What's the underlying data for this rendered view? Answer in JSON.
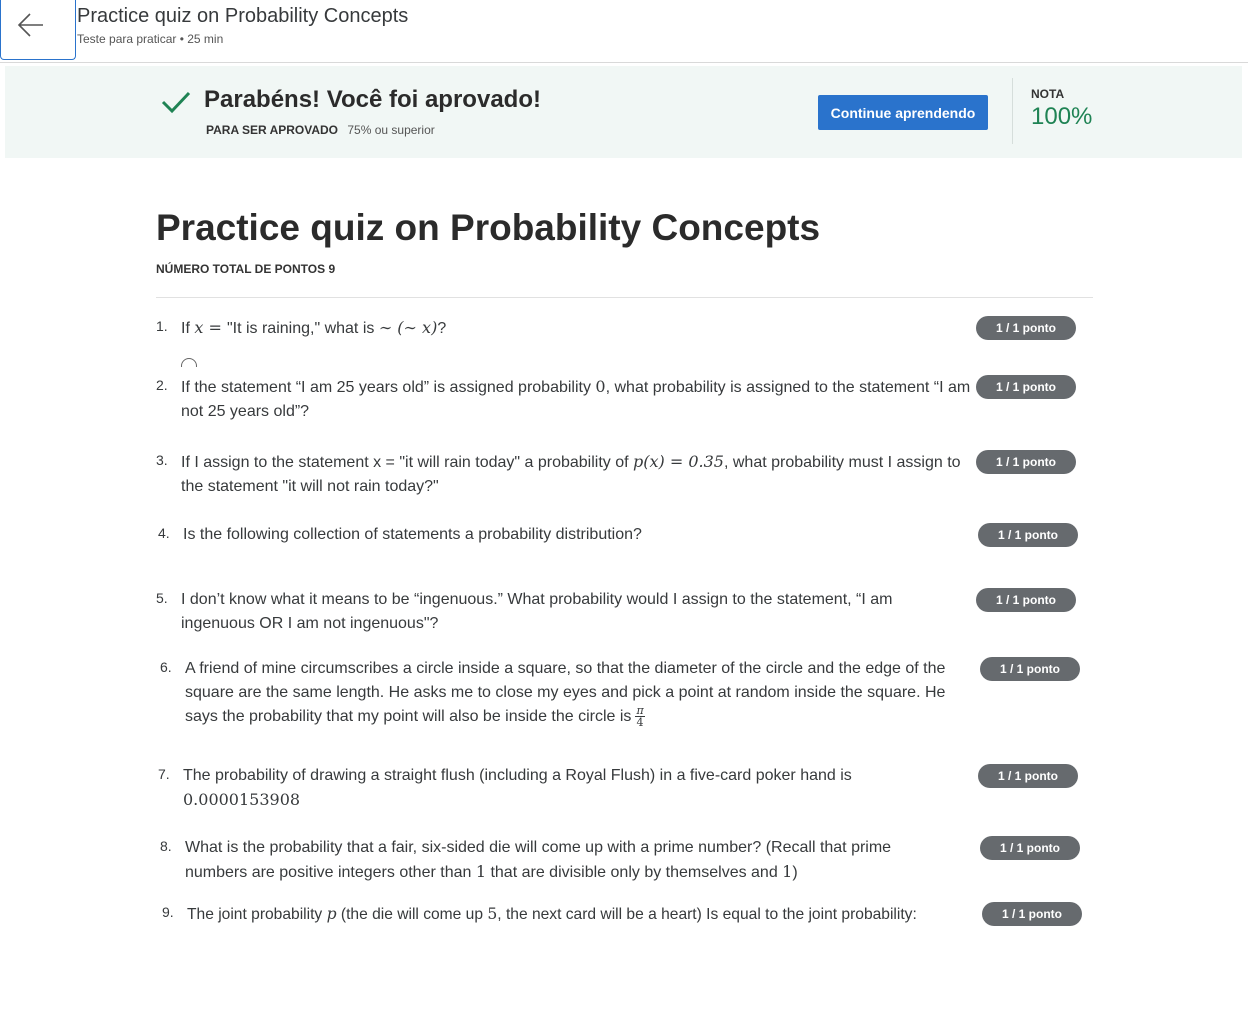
{
  "header": {
    "title": "Practice quiz on Probability Concepts",
    "subtitle": "Teste para praticar • 25 min"
  },
  "banner": {
    "message": "Parabéns! Você foi aprovado!",
    "pass_label": "PARA SER APROVADO",
    "pass_value": "75% ou superior",
    "continue_label": "Continue aprendendo",
    "grade_label": "NOTA",
    "grade_value": "100%"
  },
  "quiz": {
    "title": "Practice quiz on Probability Concepts",
    "total_points": "NÚMERO TOTAL DE PONTOS 9",
    "badge": "1 / 1 ponto",
    "questions": [
      {
        "number": "1.",
        "parts": [
          "If ",
          "x = ",
          "\"It is raining,\" what is ",
          "∼ (∼ x)",
          "?"
        ]
      },
      {
        "number": "2.",
        "parts": [
          "If the statement “I am 25 years old” is assigned probability ",
          "0",
          ", what probability is assigned to the statement “I am not 25 years old”?"
        ]
      },
      {
        "number": "3.",
        "parts": [
          "If I assign to the statement x = \"it will rain today\" a probability of ",
          "p(x) = 0.35",
          ", what probability must I assign to the statement \"it will not rain today?\""
        ]
      },
      {
        "number": "4.",
        "text": "Is the following collection of statements a probability distribution?"
      },
      {
        "number": "5.",
        "text": "I don’t know what it means to be “ingenuous.” What probability would I assign to the statement, “I am ingenuous OR I am not ingenuous\"?"
      },
      {
        "number": "6.",
        "parts": [
          "A friend of mine circumscribes a circle inside a square, so that the diameter of the circle and the edge of the square are the same length. He asks me to close my eyes and pick a point at random inside the square. He says the probability that my point will also be inside the circle is",
          "π",
          "4"
        ]
      },
      {
        "number": "7.",
        "parts": [
          "The probability of drawing a straight flush (including a Royal Flush) in a five-card poker hand is ",
          "0.0000153908"
        ]
      },
      {
        "number": "8.",
        "parts": [
          "What is the probability that a fair, six-sided die will come up with a prime number? (Recall that prime numbers are positive integers other than ",
          "1",
          " that are divisible only by themselves and ",
          "1",
          ")"
        ]
      },
      {
        "number": "9.",
        "parts": [
          "The joint probability ",
          "p",
          " (the die will come up ",
          "5",
          ", the next card will be a heart) Is equal to the joint probability:"
        ]
      }
    ]
  }
}
